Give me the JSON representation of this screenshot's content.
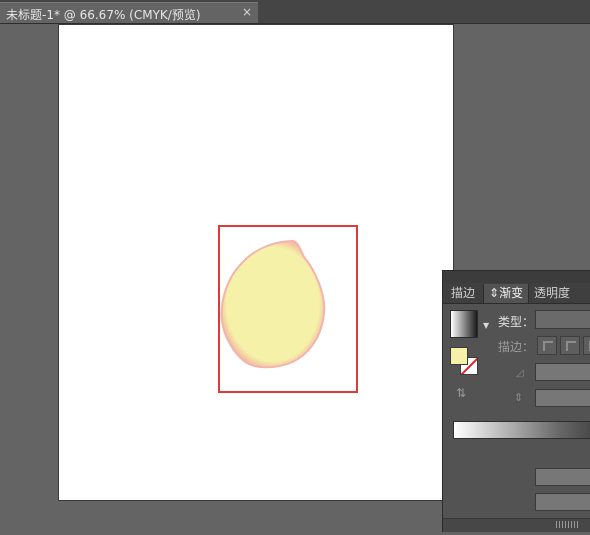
{
  "document_tab": {
    "title": "未标题-1* @ 66.67% (CMYK/预览)",
    "close_icon": "close-icon",
    "close_glyph": "×"
  },
  "canvas": {
    "background_color": "#646464",
    "artboard_color": "#ffffff",
    "shape_fill_color": "#f6f1a8",
    "shape_edge_color": "#f0a7a0",
    "selection_color": "#e0393a"
  },
  "gradient_panel": {
    "tabs": [
      {
        "label": "描边",
        "active": false
      },
      {
        "label": "渐变",
        "active": true,
        "prefix": "⇕"
      },
      {
        "label": "透明度",
        "active": false
      }
    ],
    "type_label": "类型：",
    "stroke_label": "描边：",
    "swatch_dropdown_glyph": "▼",
    "fill_color": "#f6f1a8",
    "angle_icon_glyph": "◿",
    "ratio_icon_glyph": "⇕",
    "reverse_icon_glyph": "⇅"
  }
}
